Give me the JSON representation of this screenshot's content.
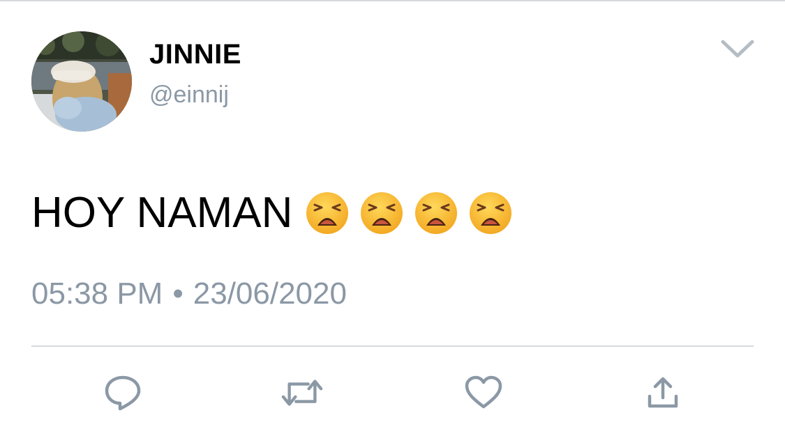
{
  "user": {
    "display_name": "JINNIE",
    "handle": "@einnij"
  },
  "tweet": {
    "text": "HOY NAMAN",
    "emoji_count": 4,
    "emoji": "weary-face",
    "time": "05:38 PM",
    "separator": "•",
    "date": "23/06/2020"
  },
  "icons": {
    "menu": "chevron-down-icon",
    "reply": "reply-icon",
    "retweet": "retweet-icon",
    "like": "heart-icon",
    "share": "share-icon"
  },
  "colors": {
    "secondary_text": "#8b98a5",
    "icon": "#8b98a5",
    "divider": "#d6d9dc",
    "emoji_face": "#f7b82c"
  }
}
